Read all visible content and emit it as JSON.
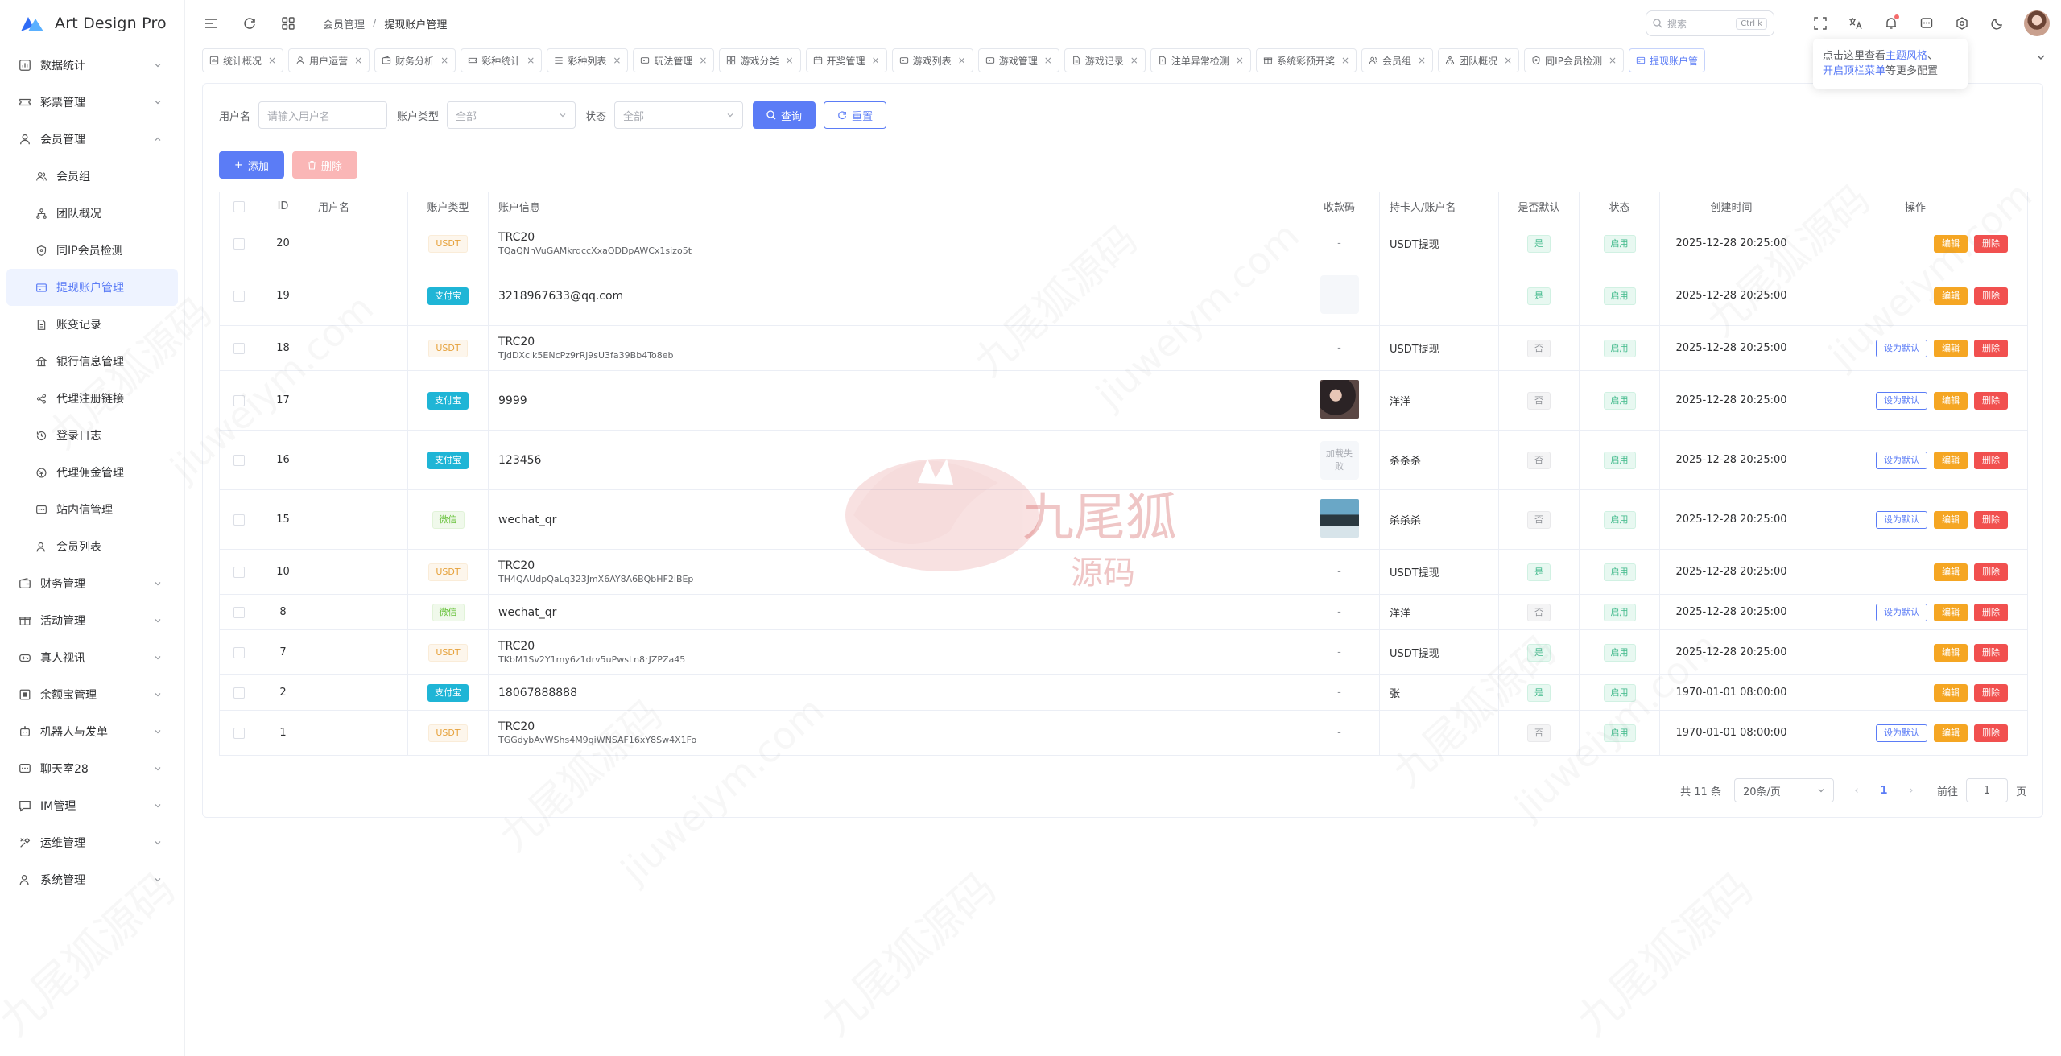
{
  "app": {
    "title": "Art Design Pro"
  },
  "sidebar": {
    "items": [
      {
        "label": "数据统计",
        "icon": "chart-icon",
        "expandable": true
      },
      {
        "label": "彩票管理",
        "icon": "ticket-icon",
        "expandable": true
      },
      {
        "label": "会员管理",
        "icon": "user-icon",
        "expandable": true,
        "open": true,
        "children": [
          {
            "label": "会员组",
            "icon": "users-icon"
          },
          {
            "label": "团队概况",
            "icon": "org-icon"
          },
          {
            "label": "同IP会员检测",
            "icon": "shield-icon"
          },
          {
            "label": "提现账户管理",
            "icon": "card-icon",
            "active": true
          },
          {
            "label": "账变记录",
            "icon": "doc-icon"
          },
          {
            "label": "银行信息管理",
            "icon": "bank-icon"
          },
          {
            "label": "代理注册链接",
            "icon": "share-icon"
          },
          {
            "label": "登录日志",
            "icon": "history-icon"
          },
          {
            "label": "代理佣金管理",
            "icon": "commission-icon"
          },
          {
            "label": "站内信管理",
            "icon": "message-icon"
          },
          {
            "label": "会员列表",
            "icon": "user-list-icon"
          }
        ]
      },
      {
        "label": "财务管理",
        "icon": "wallet-icon",
        "expandable": true
      },
      {
        "label": "活动管理",
        "icon": "gift-icon",
        "expandable": true
      },
      {
        "label": "真人视讯",
        "icon": "gamepad-icon",
        "expandable": true
      },
      {
        "label": "余额宝管理",
        "icon": "safe-icon",
        "expandable": true
      },
      {
        "label": "机器人与发单",
        "icon": "robot-icon",
        "expandable": true
      },
      {
        "label": "聊天室28",
        "icon": "chat-icon",
        "expandable": true
      },
      {
        "label": "IM管理",
        "icon": "im-icon",
        "expandable": true
      },
      {
        "label": "运维管理",
        "icon": "tools-icon",
        "expandable": true
      },
      {
        "label": "系统管理",
        "icon": "user-gear-icon",
        "expandable": true
      }
    ]
  },
  "header": {
    "breadcrumb": [
      "会员管理",
      "提现账户管理"
    ],
    "search_placeholder": "搜索",
    "search_kbd": "Ctrl k"
  },
  "tabs": [
    {
      "label": "统计概况",
      "icon": "chart-icon"
    },
    {
      "label": "用户运营",
      "icon": "user-icon"
    },
    {
      "label": "财务分析",
      "icon": "wallet-icon"
    },
    {
      "label": "彩种统计",
      "icon": "ticket-icon"
    },
    {
      "label": "彩种列表",
      "icon": "list-icon"
    },
    {
      "label": "玩法管理",
      "icon": "game-icon"
    },
    {
      "label": "游戏分类",
      "icon": "grid-icon"
    },
    {
      "label": "开奖管理",
      "icon": "calendar-icon"
    },
    {
      "label": "游戏列表",
      "icon": "game-icon"
    },
    {
      "label": "游戏管理",
      "icon": "game-icon"
    },
    {
      "label": "游戏记录",
      "icon": "doc-icon"
    },
    {
      "label": "注单异常检测",
      "icon": "alert-icon"
    },
    {
      "label": "系统彩预开奖",
      "icon": "gift-icon"
    },
    {
      "label": "会员组",
      "icon": "users-icon"
    },
    {
      "label": "团队概况",
      "icon": "org-icon"
    },
    {
      "label": "同IP会员检测",
      "icon": "shield-icon"
    },
    {
      "label": "提现账户管",
      "icon": "card-icon",
      "active": true
    }
  ],
  "tooltip": {
    "pre": "点击这里查看",
    "link1": "主题风格",
    "mid": "、",
    "link2": "开启顶栏菜单",
    "post": "等更多配置"
  },
  "filters": {
    "username_label": "用户名",
    "username_placeholder": "请输入用户名",
    "account_type_label": "账户类型",
    "account_type_value": "全部",
    "status_label": "状态",
    "status_value": "全部",
    "query_button": "查询",
    "reset_button": "重置"
  },
  "actions": {
    "add": "添加",
    "delete": "删除"
  },
  "table": {
    "columns": [
      "ID",
      "用户名",
      "账户类型",
      "账户信息",
      "收款码",
      "持卡人/账户名",
      "是否默认",
      "状态",
      "创建时间",
      "操作"
    ],
    "op_labels": {
      "set_default": "设为默认",
      "edit": "编辑",
      "delete": "删除"
    },
    "qr_fail_text": "加载失败",
    "rows": [
      {
        "id": "20",
        "type": "USDT",
        "type_kind": "usdt",
        "acc_main": "TRC20",
        "acc_sub": "TQaQNhVuGAMkrdccXxaQDDpAWCx1sizo5t",
        "qr": "-",
        "holder": "USDT提现",
        "default": "是",
        "status": "启用",
        "created": "2025-12-28 20:25:00",
        "show_set": false
      },
      {
        "id": "19",
        "type": "支付宝",
        "type_kind": "ali",
        "acc_main": "3218967633@qq.com",
        "acc_sub": "",
        "qr": "blank",
        "holder": "",
        "default": "是",
        "status": "启用",
        "created": "2025-12-28 20:25:00",
        "show_set": false
      },
      {
        "id": "18",
        "type": "USDT",
        "type_kind": "usdt",
        "acc_main": "TRC20",
        "acc_sub": "TJdDXcik5ENcPz9rRj9sU3fa39Bb4To8eb",
        "qr": "-",
        "holder": "USDT提现",
        "default": "否",
        "status": "启用",
        "created": "2025-12-28 20:25:00",
        "show_set": true
      },
      {
        "id": "17",
        "type": "支付宝",
        "type_kind": "ali",
        "acc_main": "9999",
        "acc_sub": "",
        "qr": "photo1",
        "holder": "洋洋",
        "default": "否",
        "status": "启用",
        "created": "2025-12-28 20:25:00",
        "show_set": true
      },
      {
        "id": "16",
        "type": "支付宝",
        "type_kind": "ali",
        "acc_main": "123456",
        "acc_sub": "",
        "qr": "fail",
        "holder": "杀杀杀",
        "default": "否",
        "status": "启用",
        "created": "2025-12-28 20:25:00",
        "show_set": true
      },
      {
        "id": "15",
        "type": "微信",
        "type_kind": "wx",
        "acc_main": "wechat_qr",
        "acc_sub": "",
        "qr": "photo2",
        "holder": "杀杀杀",
        "default": "否",
        "status": "启用",
        "created": "2025-12-28 20:25:00",
        "show_set": true
      },
      {
        "id": "10",
        "type": "USDT",
        "type_kind": "usdt",
        "acc_main": "TRC20",
        "acc_sub": "TH4QAUdpQaLq323JmX6AY8A6BQbHF2iBEp",
        "qr": "-",
        "holder": "USDT提现",
        "default": "是",
        "status": "启用",
        "created": "2025-12-28 20:25:00",
        "show_set": false
      },
      {
        "id": "8",
        "type": "微信",
        "type_kind": "wx",
        "acc_main": "wechat_qr",
        "acc_sub": "",
        "qr": "-",
        "holder": "洋洋",
        "default": "否",
        "status": "启用",
        "created": "2025-12-28 20:25:00",
        "show_set": true
      },
      {
        "id": "7",
        "type": "USDT",
        "type_kind": "usdt",
        "acc_main": "TRC20",
        "acc_sub": "TKbM1Sv2Y1my6z1drv5uPwsLn8rJZPZa45",
        "qr": "-",
        "holder": "USDT提现",
        "default": "是",
        "status": "启用",
        "created": "2025-12-28 20:25:00",
        "show_set": false
      },
      {
        "id": "2",
        "type": "支付宝",
        "type_kind": "ali",
        "acc_main": "18067888888",
        "acc_sub": "",
        "qr": "-",
        "holder": "张",
        "default": "是",
        "status": "启用",
        "created": "1970-01-01 08:00:00",
        "show_set": false
      },
      {
        "id": "1",
        "type": "USDT",
        "type_kind": "usdt",
        "acc_main": "TRC20",
        "acc_sub": "TGGdybAvWShs4M9qiWNSAF16xY8Sw4X1Fo",
        "qr": "-",
        "holder": "",
        "default": "否",
        "status": "启用",
        "created": "1970-01-01 08:00:00",
        "show_set": true
      }
    ]
  },
  "pagination": {
    "total": "共 11 条",
    "page_size": "20条/页",
    "current": "1",
    "goto_label": "前往",
    "goto_value": "1",
    "page_suffix": "页"
  },
  "watermark": {
    "site": "jiuweiym.com",
    "brand": "九尾狐源码",
    "logo_title": "九尾狐",
    "logo_sub": "源码"
  },
  "colors": {
    "primary": "#5b7cf6",
    "danger": "#f1504f",
    "warning": "#f5a623",
    "success": "#3fb98a",
    "alipay": "#1fb5d6"
  }
}
